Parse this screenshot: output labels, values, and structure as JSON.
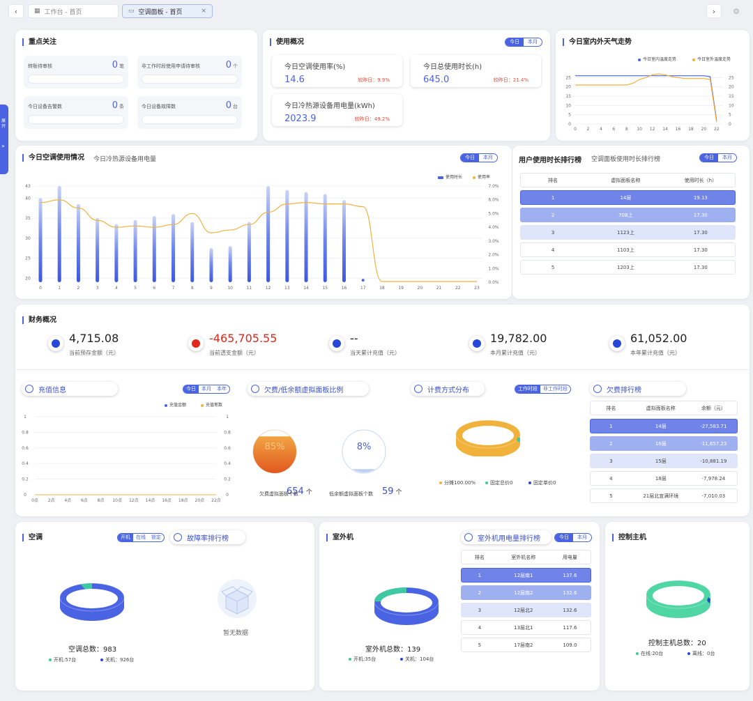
{
  "tabs": [
    {
      "label": "工作台 - 首页"
    },
    {
      "label": "空调面板 - 首页"
    }
  ],
  "side_tab": {
    "label": "展开"
  },
  "focus": {
    "title": "重点关注",
    "items": [
      {
        "label": "转账待审核",
        "value": "0",
        "unit": "笔"
      },
      {
        "label": "非工作时段使用申请待审核",
        "value": "0",
        "unit": "个"
      },
      {
        "label": "今日设备告警数",
        "value": "0",
        "unit": "条"
      },
      {
        "label": "今日设备故障数",
        "value": "0",
        "unit": "台"
      }
    ]
  },
  "usage": {
    "title": "使用概况",
    "toggle": [
      "今日",
      "本月"
    ],
    "stats": [
      {
        "label": "今日空调使用率(%)",
        "value": "14.6",
        "compare": "较昨日：9.9%"
      },
      {
        "label": "今日总使用时长(h)",
        "value": "645.0",
        "compare": "较昨日：21.4%"
      },
      {
        "label": "今日冷热源设备用电量(kWh)",
        "value": "2023.9",
        "compare": "较昨日：49.2%"
      }
    ]
  },
  "weather": {
    "title": "今日室内外天气走势",
    "legend": [
      "今日室内温度走势",
      "今日室外温度走势"
    ],
    "colors": [
      "#4a63e3",
      "#f1b23c"
    ],
    "chart_data": {
      "type": "line",
      "x": [
        0,
        1,
        2,
        3,
        4,
        5,
        6,
        7,
        8,
        9,
        10,
        11,
        12,
        13,
        14,
        15,
        16,
        17,
        18,
        19,
        20,
        21,
        22,
        23
      ],
      "xticks": [
        "0",
        "2",
        "4",
        "6",
        "8",
        "10",
        "12",
        "14",
        "16",
        "18",
        "20",
        "22"
      ],
      "ylim": [
        0,
        30
      ],
      "yticks": [
        "0",
        "5",
        "10",
        "15",
        "20",
        "25"
      ],
      "series": [
        {
          "name": "今日室内温度走势",
          "values": [
            26,
            26,
            26,
            26,
            26,
            26,
            26,
            26,
            26,
            26,
            26,
            26,
            26,
            26,
            26,
            26,
            26,
            26,
            26,
            26,
            26,
            25.5,
            2,
            null
          ]
        },
        {
          "name": "今日室外温度走势",
          "values": [
            21,
            21,
            21,
            21,
            21,
            21,
            21,
            21,
            21,
            22,
            24,
            25,
            26.5,
            27,
            26.5,
            25.5,
            25,
            24.5,
            24.5,
            24.5,
            24.5,
            24,
            1,
            null
          ]
        }
      ]
    }
  },
  "ac_usage": {
    "title": "今日空调使用情况",
    "subtitle": "今日冷热源设备用电量",
    "toggle": [
      "今日",
      "本月"
    ],
    "legend": [
      "使用时长",
      "使用率"
    ],
    "chart_data": {
      "type": "bar+line",
      "categories": [
        "0",
        "1",
        "2",
        "3",
        "4",
        "5",
        "6",
        "7",
        "8",
        "9",
        "10",
        "11",
        "12",
        "13",
        "14",
        "15",
        "16",
        "17",
        "18",
        "19",
        "20",
        "21",
        "22",
        "23"
      ],
      "ylim": [
        19,
        43
      ],
      "yticks": [
        "20",
        "25",
        "30",
        "35",
        "40",
        "43"
      ],
      "y2ticks": [
        "0.0%",
        "1.0%",
        "2.0%",
        "3.0%",
        "4.0%",
        "5.0%",
        "6.0%",
        "7.0%"
      ],
      "series": [
        {
          "name": "使用时长",
          "values": [
            40,
            43,
            38.5,
            35,
            33.5,
            34.5,
            35.5,
            36,
            34,
            27.5,
            28,
            34,
            43,
            42,
            41.5,
            41,
            39.5,
            19.5,
            null,
            null,
            null,
            null,
            null,
            null
          ]
        },
        {
          "name": "使用率",
          "values": [
            5.8,
            6.0,
            5.4,
            4.5,
            4.0,
            4.1,
            4.0,
            4.2,
            5.0,
            3.6,
            3.8,
            4.2,
            5.1,
            5.7,
            5.8,
            5.7,
            5.7,
            5.5,
            0.05,
            0.05,
            0.05,
            0.05,
            0.05,
            0.05
          ]
        }
      ]
    }
  },
  "user_rank": {
    "title": "用户使用时长排行榜",
    "subtitle": "空调面板使用时长排行榜",
    "toggle": [
      "今日",
      "本月"
    ],
    "headers": [
      "排名",
      "虚拟面板名称",
      "使用时长（h）"
    ],
    "rows": [
      [
        "1",
        "14层",
        "19.13"
      ],
      [
        "2",
        "70B上",
        "17.30"
      ],
      [
        "3",
        "1123上",
        "17.30"
      ],
      [
        "4",
        "1103上",
        "17.30"
      ],
      [
        "5",
        "1203上",
        "17.30"
      ]
    ]
  },
  "finance": {
    "title": "财务概况",
    "items": [
      {
        "value": "4,715.08",
        "label": "当前预存金额（元）",
        "color": "#2747d8"
      },
      {
        "value": "-465,705.55",
        "label": "当前透支金额（元）",
        "color": "#e0281c"
      },
      {
        "value": "--",
        "label": "当天累计充值（元）",
        "color": "#2747d8"
      },
      {
        "value": "19,782.00",
        "label": "本月累计充值（元）",
        "color": "#2747d8"
      },
      {
        "value": "61,052.00",
        "label": "本年累计充值（元）",
        "color": "#2747d8"
      }
    ]
  },
  "recharge": {
    "title": "充值信息",
    "toggle": [
      "今日",
      "本月",
      "本年"
    ],
    "legend": [
      "充值金额",
      "充值笔数"
    ],
    "chart_data": {
      "type": "line",
      "categories": [
        "0点",
        "2点",
        "4点",
        "6点",
        "8点",
        "10点",
        "12点",
        "14点",
        "16点",
        "18点",
        "20点",
        "22点"
      ],
      "ylim": [
        0,
        1
      ],
      "yticks": [
        "0",
        "0.2",
        "0.4",
        "0.6",
        "0.8",
        "1"
      ],
      "series": [
        {
          "name": "充值金额",
          "values": [
            0,
            0,
            0,
            0,
            0,
            0,
            0,
            0,
            0,
            0,
            0,
            0
          ]
        },
        {
          "name": "充值笔数",
          "values": [
            0,
            0,
            0,
            0,
            0,
            0,
            0,
            0,
            0,
            0,
            0,
            0
          ]
        }
      ]
    }
  },
  "arrears": {
    "title": "欠费/低余额虚拟面板比例",
    "gauges": [
      {
        "percent": "85%",
        "fill": 0.85,
        "label": "欠费虚拟面板个数",
        "count": "654",
        "unit": "个"
      },
      {
        "percent": "8%",
        "fill": 0.08,
        "label": "低余额虚拟面板个数",
        "count": "59",
        "unit": "个"
      }
    ]
  },
  "billing": {
    "title": "计费方式分布",
    "toggle": [
      "工作时段",
      "非工作时段"
    ],
    "legend": [
      "分摊100.00%",
      "固定总价0",
      "固定单价0"
    ],
    "colors": [
      "#f1b23c",
      "#3fc9a0",
      "#2747d8"
    ],
    "chart_data": {
      "type": "pie",
      "labels": [
        "分摊",
        "固定总价",
        "固定单价"
      ],
      "values": [
        100,
        0,
        0
      ]
    }
  },
  "arrears_rank": {
    "title": "欠费排行榜",
    "headers": [
      "排名",
      "虚拟面板名称",
      "余额（元）"
    ],
    "rows": [
      [
        "1",
        "14层",
        "-27,583.71"
      ],
      [
        "2",
        "16层",
        "-11,657.23"
      ],
      [
        "3",
        "15层",
        "-10,881.19"
      ],
      [
        "4",
        "18层",
        "-7,978.24"
      ],
      [
        "5",
        "21层北宣满环境",
        "-7,010.03"
      ]
    ]
  },
  "ac": {
    "title": "空调",
    "toggle": [
      "开机",
      "在线",
      "锁定"
    ],
    "fault_title": "故障率排行榜",
    "no_data": "暂无数据",
    "total": "空调总数：983",
    "legend": [
      "开机:57台",
      "关机：926台"
    ],
    "chart_data": {
      "type": "pie",
      "labels": [
        "开机",
        "关机"
      ],
      "values": [
        57,
        926
      ]
    }
  },
  "outdoor": {
    "title": "室外机",
    "rank_title": "室外机用电量排行榜",
    "toggle": [
      "今日",
      "本月"
    ],
    "total": "室外机总数：139",
    "legend": [
      "开机:35台",
      "关机：104台"
    ],
    "headers": [
      "排名",
      "室外机名称",
      "用电量"
    ],
    "rows": [
      [
        "1",
        "12层南1",
        "137.6"
      ],
      [
        "2",
        "12层南2",
        "132.6"
      ],
      [
        "3",
        "12层北2",
        "132.6"
      ],
      [
        "4",
        "13层北1",
        "117.6"
      ],
      [
        "5",
        "17层南2",
        "109.0"
      ]
    ],
    "chart_data": {
      "type": "pie",
      "labels": [
        "开机",
        "关机"
      ],
      "values": [
        35,
        104
      ]
    }
  },
  "host": {
    "title": "控制主机",
    "total": "控制主机总数：20",
    "legend": [
      "在线:20台",
      "离线：0台"
    ],
    "chart_data": {
      "type": "pie",
      "labels": [
        "在线",
        "离线"
      ],
      "values": [
        20,
        0
      ]
    }
  }
}
